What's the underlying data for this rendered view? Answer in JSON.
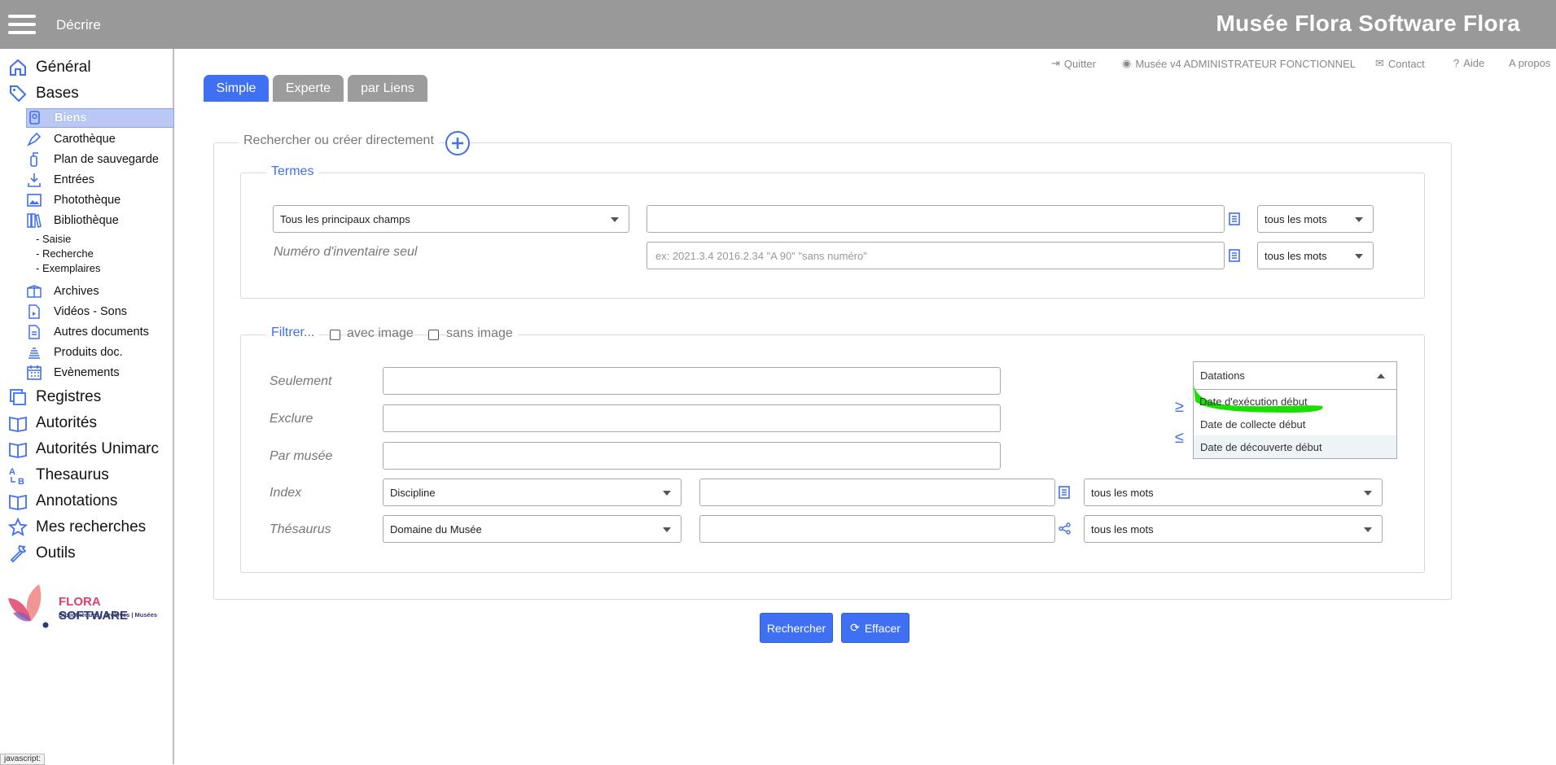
{
  "header": {
    "section": "Décrire",
    "brand": "Musée Flora Software Flora"
  },
  "sidebar": {
    "top_items": [
      {
        "label": "Général",
        "icon": "home-icon"
      },
      {
        "label": "Bases",
        "icon": "tag-icon"
      }
    ],
    "bases_items": [
      {
        "label": "Biens",
        "icon": "object-icon",
        "active": true
      },
      {
        "label": "Carothèque",
        "icon": "pen-icon"
      },
      {
        "label": "Plan de sauvegarde",
        "icon": "extinguisher-icon"
      },
      {
        "label": "Entrées",
        "icon": "download-icon"
      },
      {
        "label": "Photothèque",
        "icon": "image-icon"
      },
      {
        "label": "Bibliothèque",
        "icon": "books-icon"
      }
    ],
    "bibliotheque_sub": [
      "- Saisie",
      "- Recherche",
      "- Exemplaires"
    ],
    "more_bases_items": [
      {
        "label": "Archives",
        "icon": "archive-box-icon"
      },
      {
        "label": "Vidéos - Sons",
        "icon": "video-file-icon"
      },
      {
        "label": "Autres documents",
        "icon": "document-icon"
      },
      {
        "label": "Produits doc.",
        "icon": "stack-icon"
      },
      {
        "label": "Evènements",
        "icon": "calendar-icon"
      }
    ],
    "bottom_items": [
      {
        "label": "Registres",
        "icon": "registers-icon"
      },
      {
        "label": "Autorités",
        "icon": "open-book-icon"
      },
      {
        "label": "Autorités Unimarc",
        "icon": "open-book-icon"
      },
      {
        "label": "Thesaurus",
        "icon": "a-to-b-icon"
      },
      {
        "label": "Annotations",
        "icon": "open-book-icon"
      },
      {
        "label": "Mes recherches",
        "icon": "star-icon"
      },
      {
        "label": "Outils",
        "icon": "wrench-icon"
      }
    ],
    "logo": {
      "name_a": "FLORA",
      "name_b": " SOFTWARE",
      "tagline": "Bibliothèques | Archives | Musées"
    },
    "status_text": "javascript:"
  },
  "utility_links": {
    "quit": "Quitter",
    "user": "Musée v4 ADMINISTRATEUR FONCTIONNEL",
    "contact": "Contact",
    "help": "Aide",
    "about": "A propos"
  },
  "tabs": [
    "Simple",
    "Experte",
    "par Liens"
  ],
  "search": {
    "legend": "Rechercher ou créer directement",
    "terms": {
      "legend": "Termes",
      "field_select": "Tous les principaux champs",
      "field_value": "",
      "mode1": "tous les mots",
      "inventory_label": "Numéro d'inventaire seul",
      "inventory_placeholder": "ex: 2021.3.4 2016.2.34 \"A 90\" \"sans numéro\"",
      "mode2": "tous les mots"
    },
    "filter": {
      "legend": "Filtrer...",
      "with_image": "avec image",
      "without_image": "sans image",
      "rows": {
        "only": "Seulement",
        "exclude": "Exclure",
        "by_museum": "Par musée",
        "index": "Index",
        "thesaurus": "Thésaurus"
      },
      "index_select": "Discipline",
      "index_mode": "tous les mots",
      "thesaurus_select": "Domaine du Musée",
      "thesaurus_mode": "tous les mots",
      "gte_symbol": "≥",
      "lte_symbol": "≤",
      "dating": {
        "selected": "Datations",
        "options": [
          "Date d'exécution début",
          "Date de collecte début",
          "Date de découverte début"
        ],
        "highlight_color": "#19e000"
      }
    },
    "buttons": {
      "search": "Rechercher",
      "clear": "Effacer"
    }
  },
  "colors": {
    "accent": "#3f6ff2",
    "topbar": "#999999"
  }
}
